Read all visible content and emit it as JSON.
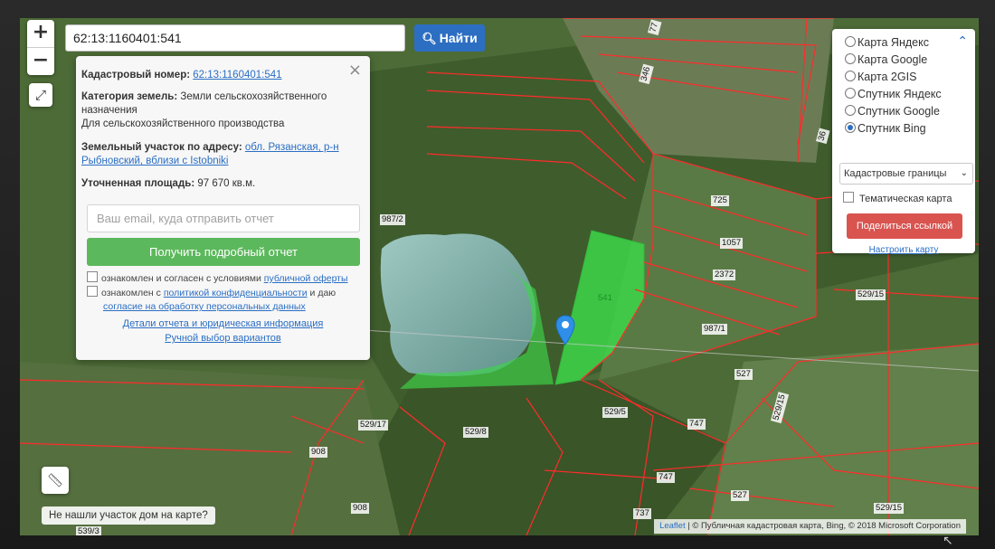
{
  "search": {
    "value": "62:13:1160401:541",
    "button_label": "Найти",
    "button_icon": "search-icon"
  },
  "zoom": {
    "in_label": "+",
    "out_label": "−"
  },
  "info": {
    "cadastral_label": "Кадастровый номер:",
    "cadastral_value": "62:13:1160401:541",
    "category_label": "Категория земель:",
    "category_value": "Земли сельскохозяйственного назначения",
    "usage": "Для сельскохозяйственного производства",
    "address_label": "Земельный участок по адресу:",
    "address_value": "обл. Рязанская, р-н Рыбновский, вблизи с Istobniki",
    "area_label": "Уточненная площадь:",
    "area_value": "97 670 кв.м.",
    "email_placeholder": "Ваш email, куда отправить отчет",
    "report_button": "Получить подробный отчет",
    "offer_text": "ознакомлен и согласен с условиями",
    "offer_link": "публичной оферты",
    "policy_text_1": "ознакомлен с",
    "policy_link": "политикой конфиденциальности",
    "policy_text_2": "и даю",
    "consent_link": "согласие на обработку персональных данных",
    "details_link": "Детали отчета и юридическая информация",
    "manual_link": "Ручной выбор вариантов"
  },
  "layers": {
    "options": [
      {
        "label": "Карта Яндекс",
        "selected": false
      },
      {
        "label": "Карта Google",
        "selected": false
      },
      {
        "label": "Карта 2GIS",
        "selected": false
      },
      {
        "label": "Спутник Яндекс",
        "selected": false
      },
      {
        "label": "Спутник Google",
        "selected": false
      },
      {
        "label": "Спутник Bing",
        "selected": true
      }
    ],
    "select_value": "Кадастровые границы",
    "thematic_label": "Тематическая карта",
    "share_button": "Поделиться ссылкой",
    "tune_link": "Настроить карту"
  },
  "bottom": {
    "not_found": "Не нашли участок дом на карте?"
  },
  "attribution": {
    "leaflet": "Leaflet",
    "rest": "| © Публичная кадастровая карта, Bing, © 2018 Microsoft Corporation"
  },
  "parcel_labels": [
    "987/2",
    "725",
    "1057",
    "2372",
    "987/1",
    "529/15",
    "527",
    "529/5",
    "747",
    "529/17",
    "529/8",
    "908",
    "908",
    "747",
    "737",
    "527",
    "529/15",
    "529/15",
    "541",
    "36",
    "346",
    "77",
    "539/3"
  ],
  "colors": {
    "boundary": "#ff2b2b",
    "selected_parcel": "#3ed64a",
    "accent": "#2c6ec2",
    "report_button": "#5cb85c",
    "share_button": "#d9534f"
  }
}
